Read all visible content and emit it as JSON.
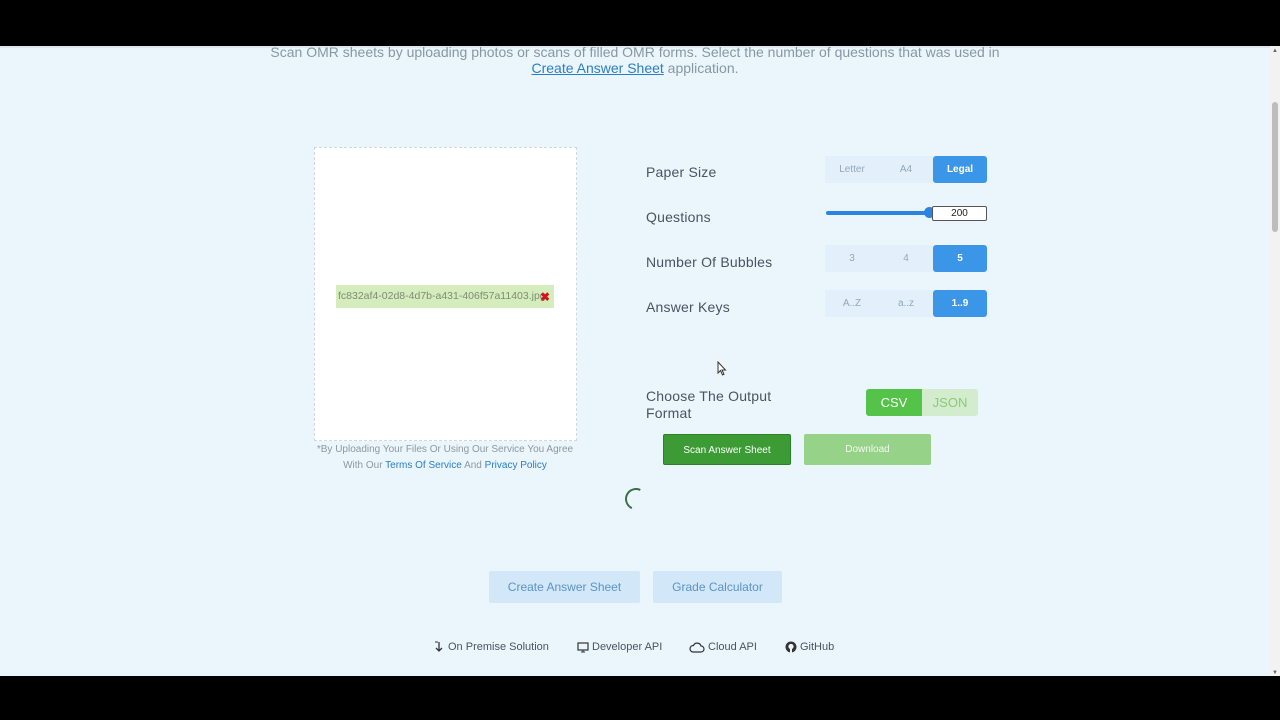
{
  "intro": {
    "line1": "Scan OMR sheets by uploading photos or scans of filled OMR forms. Select the number of questions that was used in",
    "link": "Create Answer Sheet",
    "line2_rest": " application."
  },
  "upload": {
    "file_name": "fc832af4-02d8-4d7b-a431-406f57a11403.jpg",
    "remove_glyph": "✖",
    "agree_text1": "*By Uploading Your Files Or Using Our Service You Agree",
    "agree_text2": "With Our",
    "terms_link": "Terms Of Service",
    "and_text": "And",
    "privacy_link": "Privacy Policy"
  },
  "settings": {
    "paper_size": {
      "label": "Paper Size",
      "options": [
        "Letter",
        "A4",
        "Legal"
      ],
      "selected": "Legal"
    },
    "questions": {
      "label": "Questions",
      "value": "200",
      "slider_fraction": 1.0
    },
    "bubbles": {
      "label": "Number Of Bubbles",
      "options": [
        "3",
        "4",
        "5"
      ],
      "selected": "5"
    },
    "answer_keys": {
      "label": "Answer Keys",
      "options": [
        "A..Z",
        "a..z",
        "1..9"
      ],
      "selected": "1..9"
    },
    "output_format": {
      "label_line1": "Choose The Output",
      "label_line2": "Format",
      "options": [
        "CSV",
        "JSON"
      ],
      "selected": "CSV"
    }
  },
  "actions": {
    "scan_label": "Scan Answer Sheet",
    "download_label": "Download"
  },
  "links": {
    "create_answer_sheet": "Create Answer Sheet",
    "grade_calculator": "Grade Calculator"
  },
  "footer": {
    "on_premise": "On Premise Solution",
    "developer_api": "Developer API",
    "cloud_api": "Cloud API",
    "github": "GitHub"
  },
  "colors": {
    "page_bg": "#eaf5fc",
    "selected_blue": "#3c96e8",
    "scan_green": "#3c9b34",
    "csv_green": "#55c24a"
  }
}
